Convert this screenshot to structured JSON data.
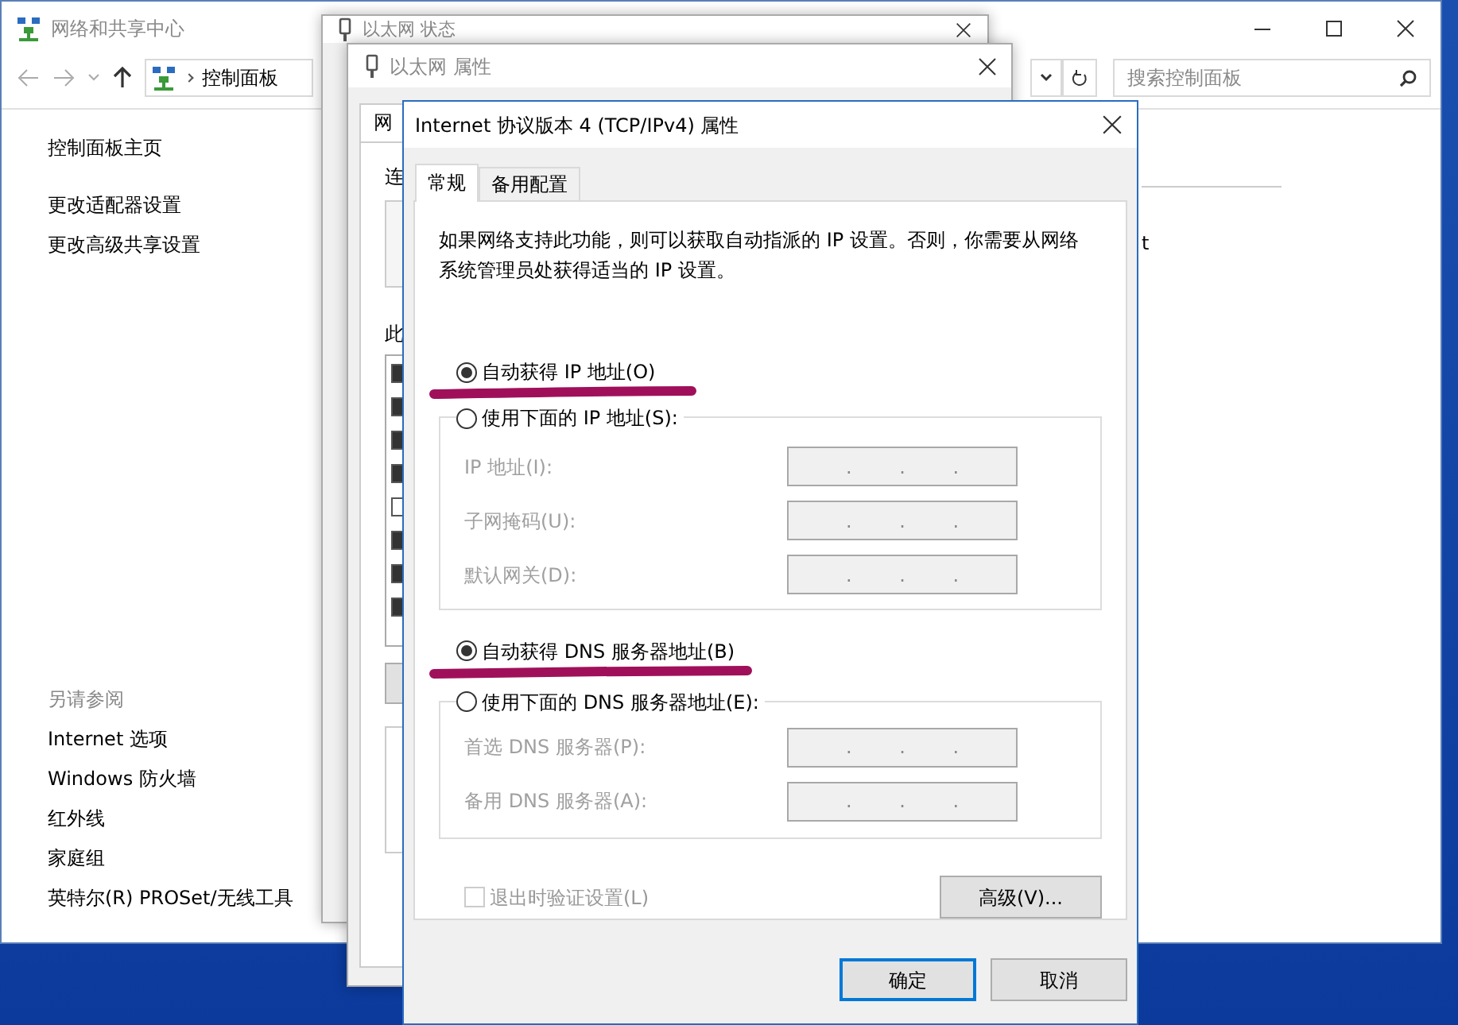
{
  "main_window": {
    "title": "网络和共享中心",
    "address_crumb": "控制面板",
    "search_placeholder": "搜索控制面板",
    "tasks": [
      "控制面板主页",
      "更改适配器设置",
      "更改高级共享设置"
    ],
    "see_also_title": "另请参阅",
    "see_also": [
      "Internet 选项",
      "Windows 防火墙",
      "红外线",
      "家庭组",
      "英特尔(R) PROSet/无线工具"
    ],
    "content_fragment": "t"
  },
  "status_window": {
    "title": "以太网 状态"
  },
  "properties_window": {
    "title": "以太网 属性",
    "tab_fragment": "网",
    "label_fragments": [
      "连",
      "此"
    ],
    "list_checks": [
      true,
      true,
      true,
      true,
      false,
      true,
      true,
      true
    ]
  },
  "dialog": {
    "title": "Internet 协议版本 4 (TCP/IPv4) 属性",
    "tabs": [
      {
        "label": "常规",
        "selected": true
      },
      {
        "label": "备用配置",
        "selected": false
      }
    ],
    "description": "如果网络支持此功能，则可以获取自动指派的 IP 设置。否则，你需要从网络系统管理员处获得适当的 IP 设置。",
    "ip_options": [
      {
        "label": "自动获得 IP 地址(O)",
        "selected": true
      },
      {
        "label": "使用下面的 IP 地址(S):",
        "selected": false
      }
    ],
    "ip_fields": [
      {
        "label": "IP 地址(I):",
        "value": ". . .",
        "disabled": true
      },
      {
        "label": "子网掩码(U):",
        "value": ". . .",
        "disabled": true
      },
      {
        "label": "默认网关(D):",
        "value": ". . .",
        "disabled": true
      }
    ],
    "dns_options": [
      {
        "label": "自动获得 DNS 服务器地址(B)",
        "selected": true
      },
      {
        "label": "使用下面的 DNS 服务器地址(E):",
        "selected": false
      }
    ],
    "dns_fields": [
      {
        "label": "首选 DNS 服务器(P):",
        "value": ". . .",
        "disabled": true
      },
      {
        "label": "备用 DNS 服务器(A):",
        "value": ". . .",
        "disabled": true
      }
    ],
    "validate": {
      "label": "退出时验证设置(L)",
      "checked": false,
      "disabled": true
    },
    "advanced_button": "高级(V)...",
    "buttons": [
      {
        "label": "确定",
        "default": true
      },
      {
        "label": "取消",
        "default": false
      }
    ]
  }
}
